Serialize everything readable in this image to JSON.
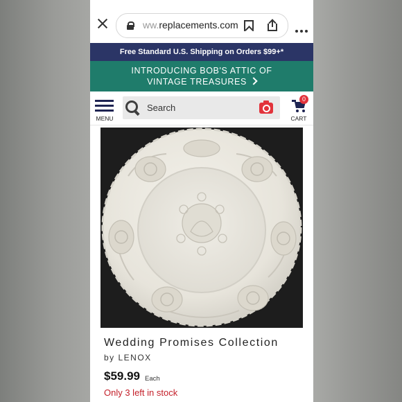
{
  "browser": {
    "url_prefix": "ww.",
    "url_domain": "replacements.com"
  },
  "banners": {
    "shipping": "Free Standard U.S. Shipping on Orders $99+*",
    "promo_line1": "INTRODUCING BOB'S ATTIC OF",
    "promo_line2": "VINTAGE TREASURES"
  },
  "header": {
    "menu_label": "MENU",
    "search_placeholder": "Search",
    "cart_label": "CART",
    "cart_count": "0"
  },
  "product": {
    "title": "Wedding Promises Collection",
    "brand": "by LENOX",
    "price": "$59.99",
    "price_unit": "Each",
    "stock": "Only 3 left in stock"
  },
  "colors": {
    "navy": "#2b3566",
    "teal": "#1f7c6b",
    "accent_red": "#e2333b",
    "stock_red": "#c4202a"
  },
  "icons": [
    "close-icon",
    "lock-icon",
    "bookmark-icon",
    "share-icon",
    "more-icon",
    "menu-icon",
    "search-icon",
    "camera-icon",
    "cart-icon"
  ]
}
